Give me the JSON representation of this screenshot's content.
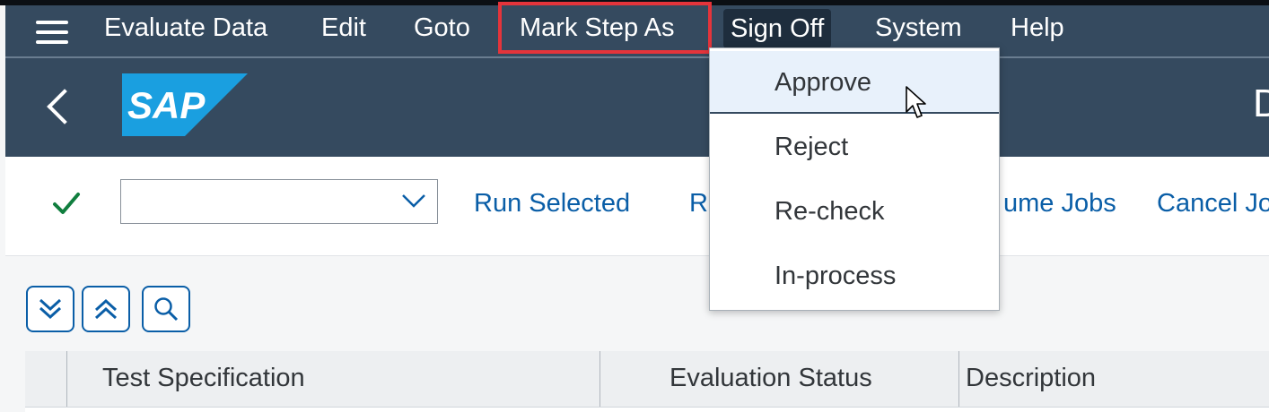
{
  "menubar": {
    "items": [
      {
        "label": "Evaluate Data"
      },
      {
        "label": "Edit"
      },
      {
        "label": "Goto"
      },
      {
        "label": "Mark Step As"
      },
      {
        "label": "Sign Off"
      },
      {
        "label": "System"
      },
      {
        "label": "Help"
      }
    ]
  },
  "shell": {
    "logo_text": "SAP",
    "title_fragment": "D"
  },
  "toolbar": {
    "combo_value": "",
    "links": [
      {
        "label": "Run Selected"
      },
      {
        "label": "R"
      },
      {
        "label": "ume Jobs"
      },
      {
        "label": "Cancel Jo"
      }
    ]
  },
  "table": {
    "columns": [
      {
        "label": "Test Specification"
      },
      {
        "label": "Evaluation Status"
      },
      {
        "label": "Description"
      }
    ]
  },
  "dropdown": {
    "items": [
      {
        "label": "Approve"
      },
      {
        "label": "Reject"
      },
      {
        "label": "Re-check"
      },
      {
        "label": "In-process"
      }
    ]
  },
  "colors": {
    "shell": "#354a5f",
    "link": "#0a5ea7",
    "highlight": "#e4343b",
    "check": "#107e3e",
    "sap_logo": "#1a9fe0"
  },
  "icons": [
    "menu-icon",
    "back-icon",
    "check-icon",
    "chevron-down-icon",
    "expand-all-icon",
    "collapse-all-icon",
    "search-icon",
    "mouse-cursor-icon"
  ]
}
